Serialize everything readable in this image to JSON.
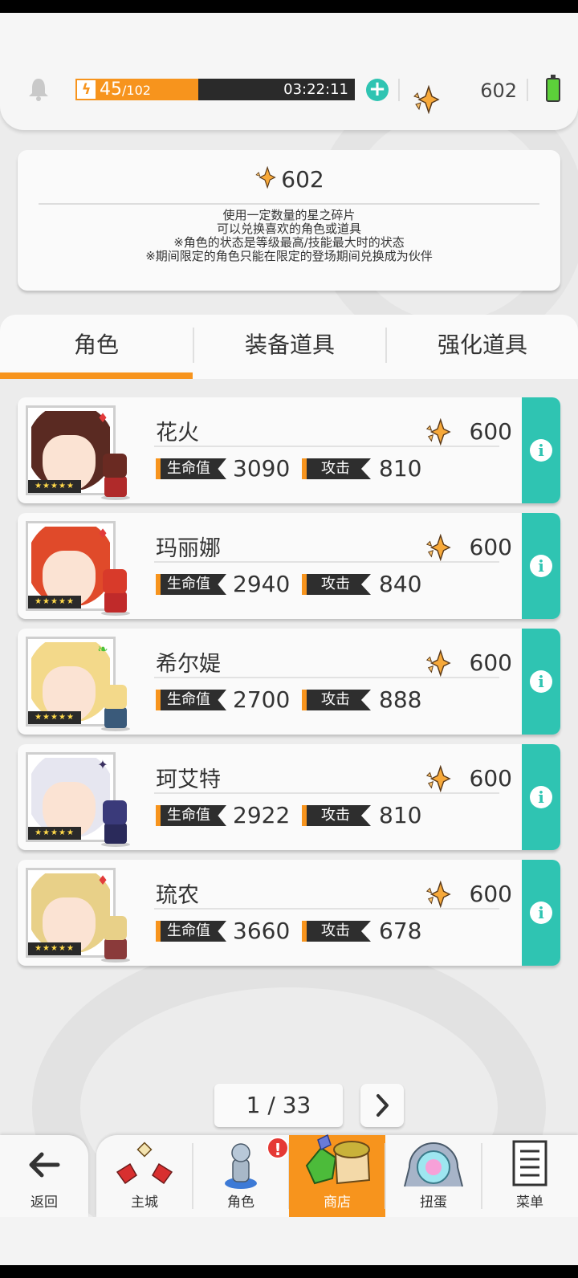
{
  "topbar": {
    "stamina_current": "45",
    "stamina_max": "/102",
    "stamina_ratio": 0.441,
    "timer": "03:22:11",
    "gems": "602"
  },
  "info": {
    "count": "602",
    "lines": [
      "使用一定数量的星之碎片",
      "可以兑换喜欢的角色或道具",
      "※角色的状态是等级最高/技能最大时的状态",
      "※期间限定的角色只能在限定的登场期间兑换成为伙伴"
    ]
  },
  "tabs": [
    "角色",
    "装备道具",
    "强化道具"
  ],
  "stat_labels": {
    "hp": "生命值",
    "atk": "攻击"
  },
  "characters": [
    {
      "name": "花火",
      "cost": "600",
      "hp": "3090",
      "atk": "810",
      "element": "♦",
      "element_color": "#e23b3b",
      "stars": "★★★★★"
    },
    {
      "name": "玛丽娜",
      "cost": "600",
      "hp": "2940",
      "atk": "840",
      "element": "♦",
      "element_color": "#e23b3b",
      "stars": "★★★★★"
    },
    {
      "name": "希尔媞",
      "cost": "600",
      "hp": "2700",
      "atk": "888",
      "element": "❧",
      "element_color": "#4cc43a",
      "stars": "★★★★★"
    },
    {
      "name": "珂艾特",
      "cost": "600",
      "hp": "2922",
      "atk": "810",
      "element": "✦",
      "element_color": "#3a3060",
      "stars": "★★★★★"
    },
    {
      "name": "琉农",
      "cost": "600",
      "hp": "3660",
      "atk": "678",
      "element": "♦",
      "element_color": "#e23b3b",
      "stars": "★★★★★"
    }
  ],
  "pagination": {
    "text": "1 / 33"
  },
  "nav": {
    "back": "返回",
    "items": [
      "主城",
      "角色",
      "商店",
      "扭蛋",
      "菜单"
    ],
    "alert": "!"
  },
  "colors": {
    "accent": "#f7941d",
    "teal": "#2fc4b2"
  }
}
